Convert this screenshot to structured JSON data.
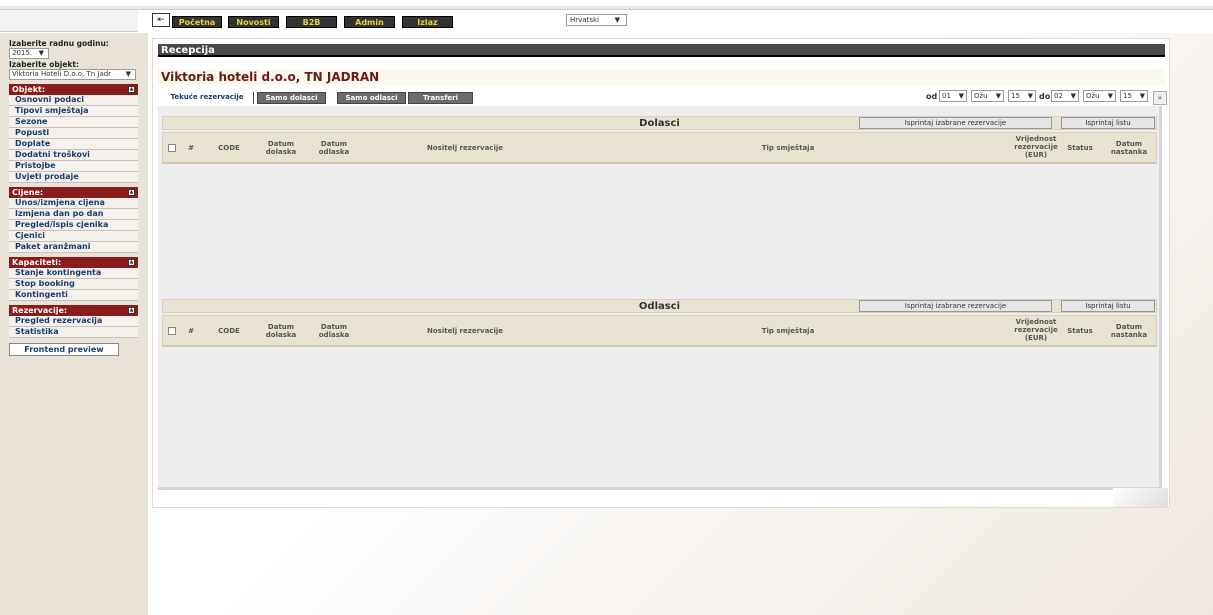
{
  "nav": {
    "buttons": [
      "Početna",
      "Novosti",
      "B2B",
      "Admin",
      "Izlaz"
    ],
    "language": "Hrvatski"
  },
  "sidebar": {
    "year_label": "Izaberite radnu godinu:",
    "year_value": "2015.",
    "object_label": "Izaberite objekt:",
    "object_value": "Viktoria Hoteli D.o.o, Tn Jadr",
    "sections": [
      {
        "title": "Objekt:",
        "items": [
          "Osnovni podaci",
          "Tipovi smještaja",
          "Sezone",
          "Popusti",
          "Doplate",
          "Dodatni troškovi",
          "Pristojbe",
          "Uvjeti prodaje"
        ]
      },
      {
        "title": "Cijene:",
        "items": [
          "Unos/izmjena cijena",
          "Izmjena dan po dan",
          "Pregled/ispis cjenika",
          "Cjenici",
          "Paket aranžmani"
        ]
      },
      {
        "title": "Kapaciteti:",
        "items": [
          "Stanje kontingenta",
          "Stop booking",
          "Kontingenti"
        ]
      },
      {
        "title": "Rezervacije:",
        "items": [
          "Pregled rezervacija",
          "Statistika"
        ]
      }
    ],
    "frontend_preview": "Frontend preview"
  },
  "main": {
    "header": "Recepcija",
    "hotel_title": "Viktoria hoteli d.o.o, TN JADRAN",
    "tabs": [
      "Tekuće rezervacije",
      "Samo dolasci",
      "Samo odlasci",
      "Transferi"
    ],
    "date_range": {
      "from_label": "od",
      "to_label": "do",
      "from_day": "01",
      "from_month": "Ožu",
      "from_year": "15",
      "to_day": "02",
      "to_month": "Ožu",
      "to_year": "15",
      "go_label": "»"
    },
    "sections": [
      {
        "title": "Dolasci",
        "print_selected": "Isprintaj izabrane rezervacije",
        "print_list": "Isprintaj listu"
      },
      {
        "title": "Odlasci",
        "print_selected": "Isprintaj izabrane rezervacije",
        "print_list": "Isprintaj listu"
      }
    ],
    "columns": {
      "hash": "#",
      "code": "CODE",
      "arrival": "Datum dolaska",
      "departure": "Datum odlaska",
      "holder": "Nositelj rezervacije",
      "room_type": "Tip smještaja",
      "value": "Vrijednost rezervacije (EUR)",
      "status": "Status",
      "created": "Datum nastanka"
    }
  }
}
